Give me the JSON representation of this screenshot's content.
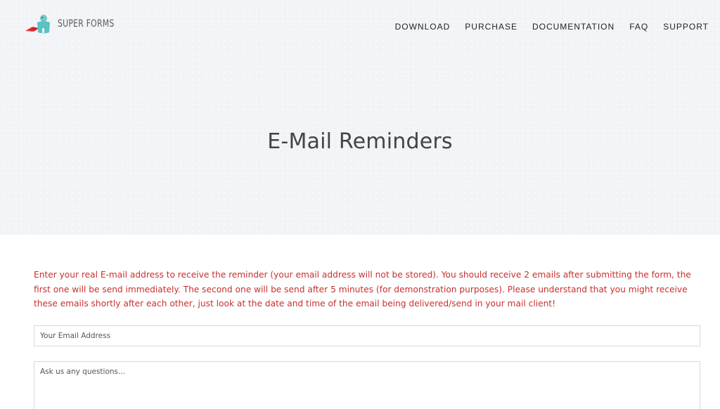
{
  "brand": {
    "name": "SUPER FORMS"
  },
  "nav": {
    "items": [
      {
        "label": "DOWNLOAD"
      },
      {
        "label": "PURCHASE"
      },
      {
        "label": "DOCUMENTATION"
      },
      {
        "label": "FAQ"
      },
      {
        "label": "SUPPORT"
      }
    ]
  },
  "hero": {
    "title": "E-Mail Reminders"
  },
  "notice": {
    "text": "Enter your real E-mail address to receive the reminder (your email address will not be stored). You should receive 2 emails after submitting the form, the first one will be send immediately. The second one will be send after 5 minutes (for demonstration purposes). Please understand that you might receive these emails shortly after each other, just look at the date and time of the email being delivered/send in your mail client!"
  },
  "form": {
    "email_placeholder": "Your Email Address",
    "questions_placeholder": "Ask us any questions..."
  },
  "colors": {
    "notice": "#c8302f",
    "hero_bg": "#f2f4f8",
    "logo_teal": "#5cc2c3",
    "logo_red": "#e23a3a"
  },
  "icons": {
    "logo": "superhero-mascot-icon"
  }
}
